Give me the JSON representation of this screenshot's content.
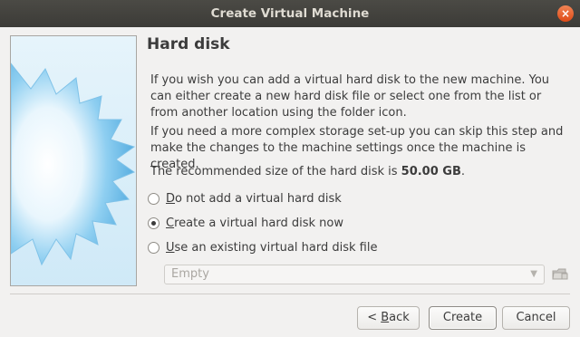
{
  "window": {
    "title": "Create Virtual Machine",
    "close_glyph": "×"
  },
  "page": {
    "title": "Hard disk",
    "paragraph1": "If you wish you can add a virtual hard disk to the new machine. You can either create a new hard disk file or select one from the list or from another location using the folder icon.",
    "paragraph2": "If you need a more complex storage set-up you can skip this step and make the changes to the machine settings once the machine is created.",
    "recommended_prefix": "The recommended size of the hard disk is ",
    "recommended_size": "50.00 GB",
    "recommended_suffix": "."
  },
  "options": [
    {
      "mnemonic": "D",
      "rest": "o not add a virtual hard disk",
      "checked": false
    },
    {
      "mnemonic": "C",
      "rest": "reate a virtual hard disk now",
      "checked": true
    },
    {
      "mnemonic": "U",
      "rest": "se an existing virtual hard disk file",
      "checked": false
    }
  ],
  "existing_disk": {
    "value": "Empty",
    "icon": "folder-icon"
  },
  "buttons": {
    "back_prefix": "< ",
    "back_mnemonic": "B",
    "back_rest": "ack",
    "create": "Create",
    "cancel": "Cancel"
  },
  "colors": {
    "titlebar": "#3c3b37",
    "close": "#df4a16",
    "background": "#f2f1f0",
    "star": "#5ab1e3"
  }
}
